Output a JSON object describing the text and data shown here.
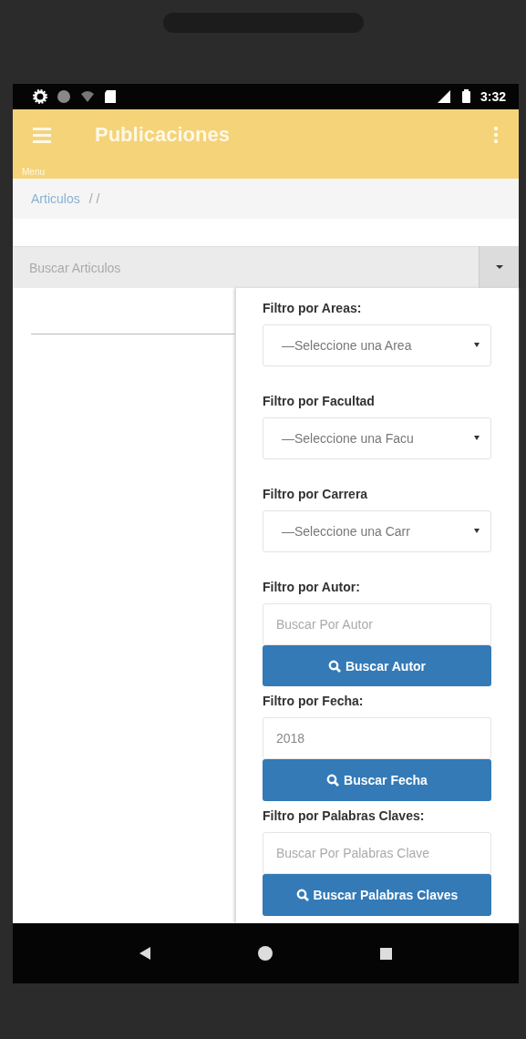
{
  "status_bar": {
    "time": "3:32"
  },
  "app_bar": {
    "title": "Publicaciones",
    "menu_label": "Menu"
  },
  "breadcrumb": {
    "items": [
      "Articulos"
    ],
    "trail": "/ /"
  },
  "search": {
    "placeholder": "Buscar Articulos"
  },
  "filters": [
    {
      "kind": "select",
      "label": "Filtro por Areas:",
      "value": "—Seleccione una Area"
    },
    {
      "kind": "select",
      "label": "Filtro por Facultad",
      "value": "—Seleccione una Facu"
    },
    {
      "kind": "select",
      "label": "Filtro por Carrera",
      "value": "—Seleccione una Carr"
    },
    {
      "kind": "search",
      "label": "Filtro por Autor:",
      "placeholder": "Buscar Por Autor",
      "button": "Buscar Autor"
    },
    {
      "kind": "search",
      "label": "Filtro por Fecha:",
      "value": "2018",
      "button": "Buscar Fecha"
    },
    {
      "kind": "search",
      "label": "Filtro por Palabras Claves:",
      "placeholder": "Buscar Por Palabras Clave",
      "button": "Buscar Palabras Claves"
    }
  ]
}
